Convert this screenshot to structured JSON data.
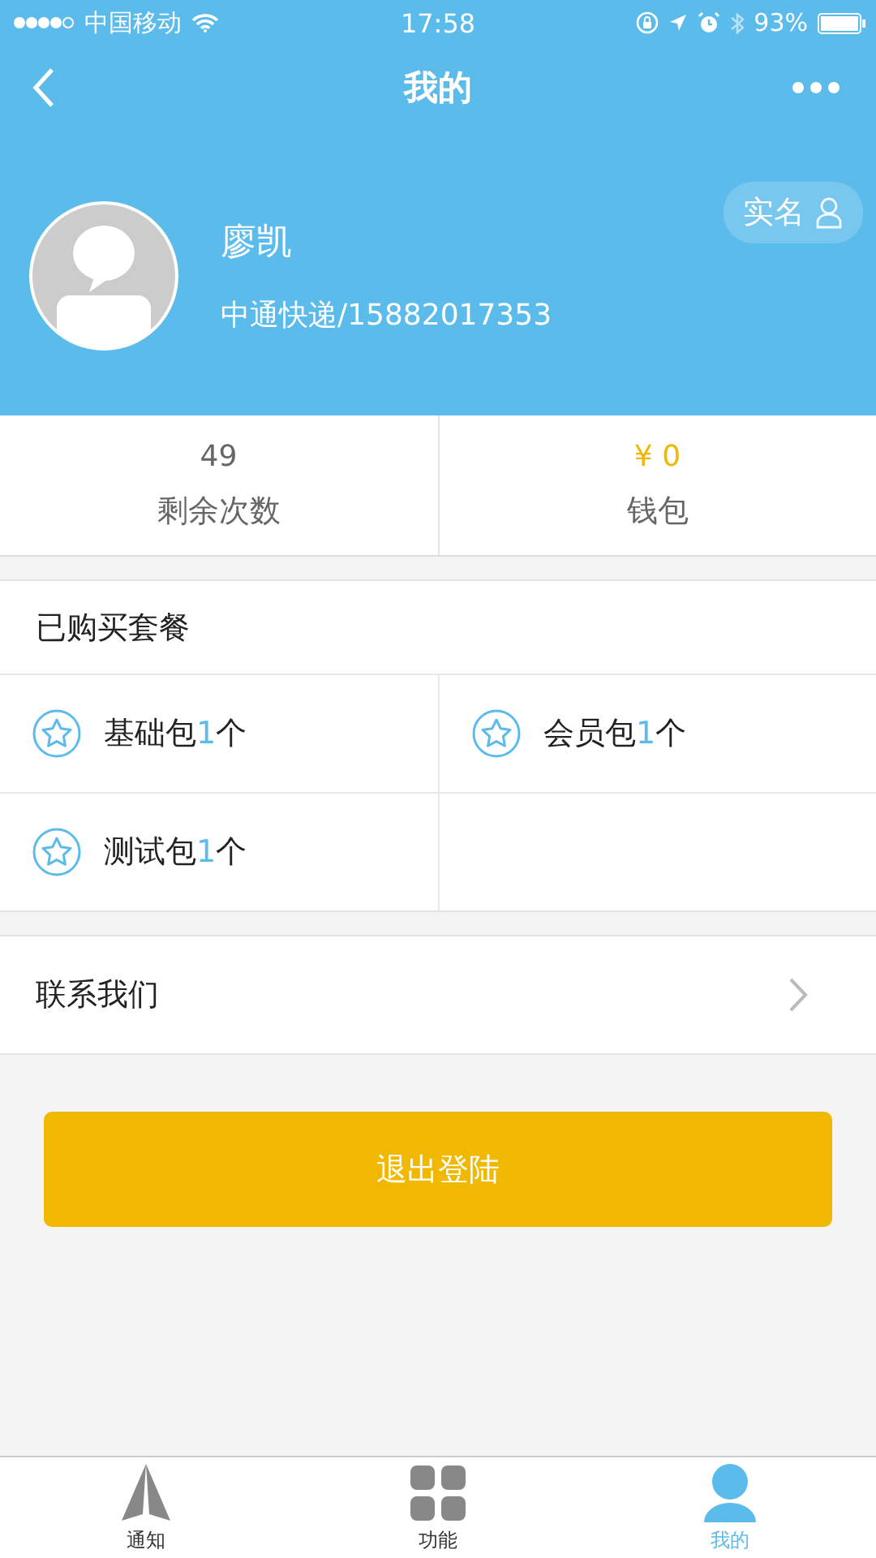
{
  "status_bar": {
    "carrier": "中国移动",
    "time": "17:58",
    "battery": "93%"
  },
  "nav": {
    "title": "我的"
  },
  "profile": {
    "name": "廖凯",
    "subtitle": "中通快递/15882017353",
    "verify_label": "实名"
  },
  "stats": [
    {
      "kind": "count",
      "value": "49",
      "label": "剩余次数"
    },
    {
      "kind": "money",
      "value": "¥ 0",
      "label": "钱包"
    }
  ],
  "packages": {
    "title": "已购买套餐",
    "items": [
      {
        "name": "基础包",
        "count": "1",
        "unit": "个"
      },
      {
        "name": "会员包",
        "count": "1",
        "unit": "个"
      },
      {
        "name": "测试包",
        "count": "1",
        "unit": "个"
      }
    ]
  },
  "contact": {
    "label": "联系我们"
  },
  "logout_button": "退出登陆",
  "tabs": [
    {
      "kind": "notice",
      "label": "通知",
      "selected": false
    },
    {
      "kind": "grid",
      "label": "功能",
      "selected": false
    },
    {
      "kind": "person",
      "label": "我的",
      "selected": true
    }
  ]
}
